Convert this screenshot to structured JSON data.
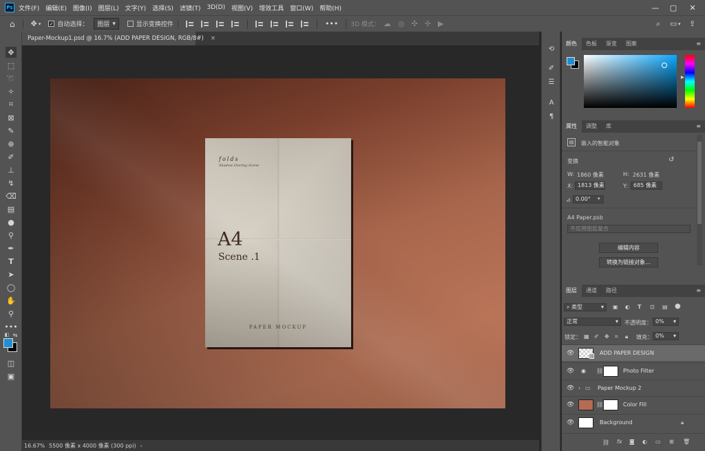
{
  "menubar": {
    "items": [
      "文件(F)",
      "编辑(E)",
      "图像(I)",
      "图层(L)",
      "文字(Y)",
      "选择(S)",
      "滤镜(T)",
      "3D(D)",
      "视图(V)",
      "增效工具",
      "窗口(W)",
      "帮助(H)"
    ],
    "logo": "Ps"
  },
  "options": {
    "auto_select_label": "自动选择：",
    "auto_select_value": "图层",
    "show_transform_label": "显示变换控件",
    "mode_label": "3D 模式："
  },
  "document": {
    "tab_title": "Paper-Mockup1.psd @ 16.7% (ADD PAPER DESIGN, RGB/8#)",
    "paper": {
      "brand": "folds",
      "subtitle": "Shadow Overlay Scene",
      "big_text": "A4",
      "scene_text": "Scene .1",
      "footer_text": "PAPER MOCKUP"
    }
  },
  "status": {
    "zoom": "16.67%",
    "info": "5500 像素 x 4000 像素 (300 ppi)"
  },
  "color_panel": {
    "tabs": [
      "颜色",
      "色板",
      "渐变",
      "图案"
    ],
    "foreground": "#1e8fd4",
    "background": "#000000"
  },
  "properties_panel": {
    "tabs": [
      "属性",
      "调整",
      "库"
    ],
    "object_type": "嵌入的智能对象",
    "transform_label": "变换",
    "w_label": "W:",
    "w_value": "1860 像素",
    "h_label": "H:",
    "h_value": "2631 像素",
    "x_label": "X:",
    "x_value": "1813 像素",
    "y_label": "Y:",
    "y_value": "685 像素",
    "angle_value": "0.00°",
    "file_name": "A4 Paper.psb",
    "comp_placeholder": "不应用图层复合",
    "edit_button": "编辑内容",
    "convert_button": "转换为链接对象..."
  },
  "layers_panel": {
    "tabs": [
      "图层",
      "通道",
      "路径"
    ],
    "filter_label": "类型",
    "blend_mode": "正常",
    "opacity_label": "不透明度：",
    "opacity_value": "0%",
    "lock_label": "锁定：",
    "fill_label": "填充：",
    "fill_value": "0%",
    "layers": [
      {
        "name": "ADD PAPER DESIGN"
      },
      {
        "name": "Photo Filter"
      },
      {
        "name": "Paper Mockup 2"
      },
      {
        "name": "Color Fill"
      },
      {
        "name": "Background"
      }
    ]
  }
}
